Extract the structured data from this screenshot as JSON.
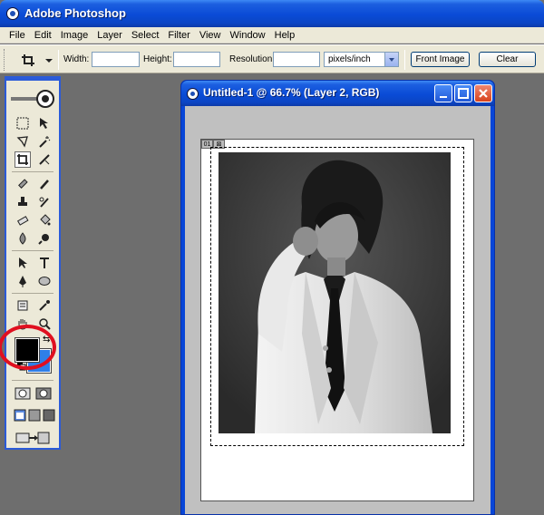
{
  "app": {
    "title": "Adobe Photoshop"
  },
  "menu": {
    "items": [
      "File",
      "Edit",
      "Image",
      "Layer",
      "Select",
      "Filter",
      "View",
      "Window",
      "Help"
    ]
  },
  "options": {
    "width_label": "Width:",
    "width_value": "",
    "height_label": "Height:",
    "height_value": "",
    "resolution_label": "Resolution:",
    "resolution_value": "",
    "units_selected": "pixels/inch",
    "front_image_label": "Front Image",
    "clear_label": "Clear"
  },
  "toolbox": {
    "foreground_color": "#000000",
    "background_color": "#2f7fe8"
  },
  "document": {
    "title": "Untitled-1 @ 66.7% (Layer 2, RGB)",
    "layer_badge": [
      "01",
      "⊠"
    ]
  },
  "colors": {
    "titlebar": "#0a4bd6",
    "chrome": "#ece9d8",
    "workspace": "#6e6e6e",
    "highlight_circle": "#e01020"
  }
}
